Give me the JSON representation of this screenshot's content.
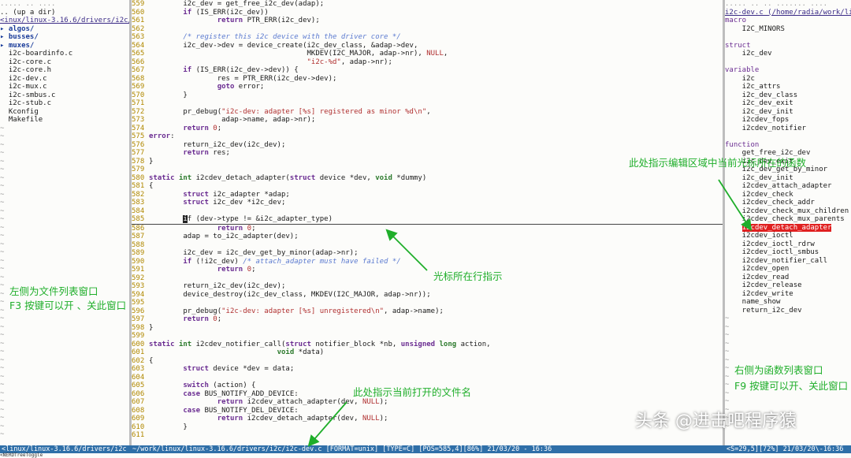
{
  "left_pane": {
    "header_top": "..... .. ....",
    "up_dir": ".. (up a dir)",
    "path": "<inux/linux-3.16.6/drivers/i2c/",
    "items": [
      {
        "name": "▸ algos/",
        "dir": true
      },
      {
        "name": "▸ busses/",
        "dir": true
      },
      {
        "name": "▸ muxes/",
        "dir": true
      },
      {
        "name": "  i2c-boardinfo.c",
        "dir": false
      },
      {
        "name": "  i2c-core.c",
        "dir": false
      },
      {
        "name": "  i2c-core.h",
        "dir": false
      },
      {
        "name": "  i2c-dev.c",
        "dir": false
      },
      {
        "name": "  i2c-mux.c",
        "dir": false
      },
      {
        "name": "  i2c-smbus.c",
        "dir": false
      },
      {
        "name": "  i2c-stub.c",
        "dir": false
      },
      {
        "name": "  Kconfig",
        "dir": false
      },
      {
        "name": "  Makefile",
        "dir": false
      }
    ],
    "tilde": "~"
  },
  "editor": {
    "lines": [
      {
        "n": "559",
        "t": "        i2c_dev = get_free_i2c_dev(adap);"
      },
      {
        "n": "560",
        "t": "        if (IS_ERR(i2c_dev))"
      },
      {
        "n": "561",
        "t": "                return PTR_ERR(i2c_dev);"
      },
      {
        "n": "562",
        "t": ""
      },
      {
        "n": "563",
        "t": "        /* register this i2c device with the driver core */"
      },
      {
        "n": "564",
        "t": "        i2c_dev->dev = device_create(i2c_dev_class, &adap->dev,"
      },
      {
        "n": "565",
        "t": "                                     MKDEV(I2C_MAJOR, adap->nr), NULL,"
      },
      {
        "n": "566",
        "t": "                                     \"i2c-%d\", adap->nr);"
      },
      {
        "n": "567",
        "t": "        if (IS_ERR(i2c_dev->dev)) {"
      },
      {
        "n": "568",
        "t": "                res = PTR_ERR(i2c_dev->dev);"
      },
      {
        "n": "569",
        "t": "                goto error;"
      },
      {
        "n": "570",
        "t": "        }"
      },
      {
        "n": "571",
        "t": ""
      },
      {
        "n": "572",
        "t": "        pr_debug(\"i2c-dev: adapter [%s] registered as minor %d\\n\","
      },
      {
        "n": "573",
        "t": "                 adap->name, adap->nr);"
      },
      {
        "n": "574",
        "t": "        return 0;"
      },
      {
        "n": "575",
        "t": "error:"
      },
      {
        "n": "576",
        "t": "        return_i2c_dev(i2c_dev);"
      },
      {
        "n": "577",
        "t": "        return res;"
      },
      {
        "n": "578",
        "t": "}"
      },
      {
        "n": "579",
        "t": ""
      },
      {
        "n": "580",
        "t": "static int i2cdev_detach_adapter(struct device *dev, void *dummy)"
      },
      {
        "n": "581",
        "t": "{"
      },
      {
        "n": "582",
        "t": "        struct i2c_adapter *adap;"
      },
      {
        "n": "583",
        "t": "        struct i2c_dev *i2c_dev;"
      },
      {
        "n": "584",
        "t": ""
      },
      {
        "n": "585",
        "t": "        if (dev->type != &i2c_adapter_type)",
        "cursor": true
      },
      {
        "n": "586",
        "t": "                return 0;"
      },
      {
        "n": "587",
        "t": "        adap = to_i2c_adapter(dev);"
      },
      {
        "n": "588",
        "t": ""
      },
      {
        "n": "589",
        "t": "        i2c_dev = i2c_dev_get_by_minor(adap->nr);"
      },
      {
        "n": "590",
        "t": "        if (!i2c_dev) /* attach_adapter must have failed */"
      },
      {
        "n": "591",
        "t": "                return 0;"
      },
      {
        "n": "592",
        "t": ""
      },
      {
        "n": "593",
        "t": "        return_i2c_dev(i2c_dev);"
      },
      {
        "n": "594",
        "t": "        device_destroy(i2c_dev_class, MKDEV(I2C_MAJOR, adap->nr));"
      },
      {
        "n": "595",
        "t": ""
      },
      {
        "n": "596",
        "t": "        pr_debug(\"i2c-dev: adapter [%s] unregistered\\n\", adap->name);"
      },
      {
        "n": "597",
        "t": "        return 0;"
      },
      {
        "n": "598",
        "t": "}"
      },
      {
        "n": "599",
        "t": ""
      },
      {
        "n": "600",
        "t": "static int i2cdev_notifier_call(struct notifier_block *nb, unsigned long action,"
      },
      {
        "n": "601",
        "t": "                              void *data)"
      },
      {
        "n": "602",
        "t": "{"
      },
      {
        "n": "603",
        "t": "        struct device *dev = data;"
      },
      {
        "n": "604",
        "t": ""
      },
      {
        "n": "605",
        "t": "        switch (action) {"
      },
      {
        "n": "606",
        "t": "        case BUS_NOTIFY_ADD_DEVICE:"
      },
      {
        "n": "607",
        "t": "                return i2cdev_attach_adapter(dev, NULL);"
      },
      {
        "n": "608",
        "t": "        case BUS_NOTIFY_DEL_DEVICE:"
      },
      {
        "n": "609",
        "t": "                return i2cdev_detach_adapter(dev, NULL);"
      },
      {
        "n": "610",
        "t": "        }"
      },
      {
        "n": "611",
        "t": ""
      }
    ]
  },
  "right_pane": {
    "header_top": "..... .. .. ....... ....",
    "title": "i2c-dev.c (/home/radia/work/linux",
    "entries": [
      {
        "t": "macro",
        "k": "cat"
      },
      {
        "t": "    I2C_MINORS",
        "k": "tag"
      },
      {
        "t": "",
        "k": "tag"
      },
      {
        "t": "struct",
        "k": "cat"
      },
      {
        "t": "    i2c_dev",
        "k": "tag"
      },
      {
        "t": "",
        "k": "tag"
      },
      {
        "t": "variable",
        "k": "cat"
      },
      {
        "t": "    i2c",
        "k": "tag"
      },
      {
        "t": "    i2c_attrs",
        "k": "tag"
      },
      {
        "t": "    i2c_dev_class",
        "k": "tag"
      },
      {
        "t": "    i2c_dev_exit",
        "k": "tag"
      },
      {
        "t": "    i2c_dev_init",
        "k": "tag"
      },
      {
        "t": "    i2cdev_fops",
        "k": "tag"
      },
      {
        "t": "    i2cdev_notifier",
        "k": "tag"
      },
      {
        "t": "",
        "k": "tag"
      },
      {
        "t": "function",
        "k": "cat"
      },
      {
        "t": "    get_free_i2c_dev",
        "k": "tag"
      },
      {
        "t": "    i2c_dev_exit",
        "k": "tag"
      },
      {
        "t": "    i2c_dev_get_by_minor",
        "k": "tag"
      },
      {
        "t": "    i2c_dev_init",
        "k": "tag"
      },
      {
        "t": "    i2cdev_attach_adapter",
        "k": "tag"
      },
      {
        "t": "    i2cdev_check",
        "k": "tag"
      },
      {
        "t": "    i2cdev_check_addr",
        "k": "tag"
      },
      {
        "t": "    i2cdev_check_mux_children",
        "k": "tag"
      },
      {
        "t": "    i2cdev_check_mux_parents",
        "k": "tag"
      },
      {
        "t": "i2cdev_detach_adapter",
        "k": "hl"
      },
      {
        "t": "    i2cdev_ioctl",
        "k": "tag"
      },
      {
        "t": "    i2cdev_ioctl_rdrw",
        "k": "tag"
      },
      {
        "t": "    i2cdev_ioctl_smbus",
        "k": "tag"
      },
      {
        "t": "    i2cdev_notifier_call",
        "k": "tag"
      },
      {
        "t": "    i2cdev_open",
        "k": "tag"
      },
      {
        "t": "    i2cdev_read",
        "k": "tag"
      },
      {
        "t": "    i2cdev_release",
        "k": "tag"
      },
      {
        "t": "    i2cdev_write",
        "k": "tag"
      },
      {
        "t": "    name_show",
        "k": "tag"
      },
      {
        "t": "    return_i2c_dev",
        "k": "tag"
      }
    ],
    "tilde": "~"
  },
  "status": {
    "left": "<linux/linux-3.16.6/drivers/i2c",
    "middle": "~/work/linux/linux-3.16.6/drivers/i2c/i2c-dev.c [FORMAT=unix] [TYPE=C] [POS=585,4][86%] 21/03/20 - 16:36",
    "right": "<S=29,5][72%] 21/03/20\\-16:36",
    "cmdline": "<NERDTreeToggle"
  },
  "annotations": {
    "left_window": "左侧为文件列表窗口",
    "left_f3": "F3 按键可以开 、关此窗口",
    "cursor_line": "光标所在行指示",
    "current_func": "此处指示编辑区域中当前光标所在的函数",
    "file_name": "此处指示当前打开的文件名",
    "right_window": "右侧为函数列表窗口",
    "right_f9": "F9 按键可以开、关此窗口"
  },
  "watermark": "头条 @进击吧程序猿",
  "colors": {
    "annotation_green": "#1fae2a",
    "status_blue": "#2f6fa8",
    "highlight_red": "#e02020"
  }
}
